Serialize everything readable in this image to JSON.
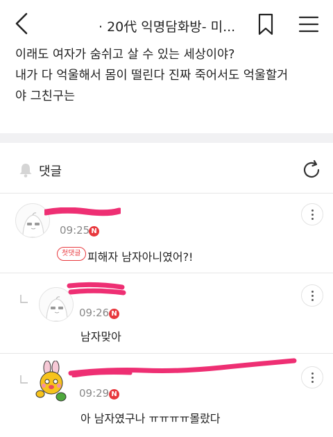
{
  "header": {
    "title": "· 20代 익명담화방- 미...",
    "back_icon": "chevron-left-icon",
    "bookmark_icon": "bookmark-icon",
    "menu_icon": "hamburger-menu-icon"
  },
  "post": {
    "lines": [
      "이래도 여자가 숨쉬고 살 수 있는 세상이야?",
      "내가 다 억울해서 몸이 떨린다 진짜 죽어서도 억울할거",
      "야 그친구는"
    ]
  },
  "comments_section": {
    "title": "댓글",
    "bell_icon": "bell-icon",
    "refresh_icon": "refresh-icon"
  },
  "comments": [
    {
      "time": "09:25",
      "new_badge": "N",
      "first_comment_badge": "첫댓글",
      "text": "피해자 남자아니였어?!",
      "is_reply": false
    },
    {
      "time": "09:26",
      "new_badge": "N",
      "text": "남자맞아",
      "is_reply": true
    },
    {
      "time": "09:29",
      "new_badge": "N",
      "text": "아 남자였구나 ㅠㅠㅠㅠ몰랐다",
      "is_reply": true
    }
  ],
  "colors": {
    "accent_red": "#e8383d",
    "redaction_pink": "#ee2f73",
    "divider": "#f1f1f3"
  }
}
